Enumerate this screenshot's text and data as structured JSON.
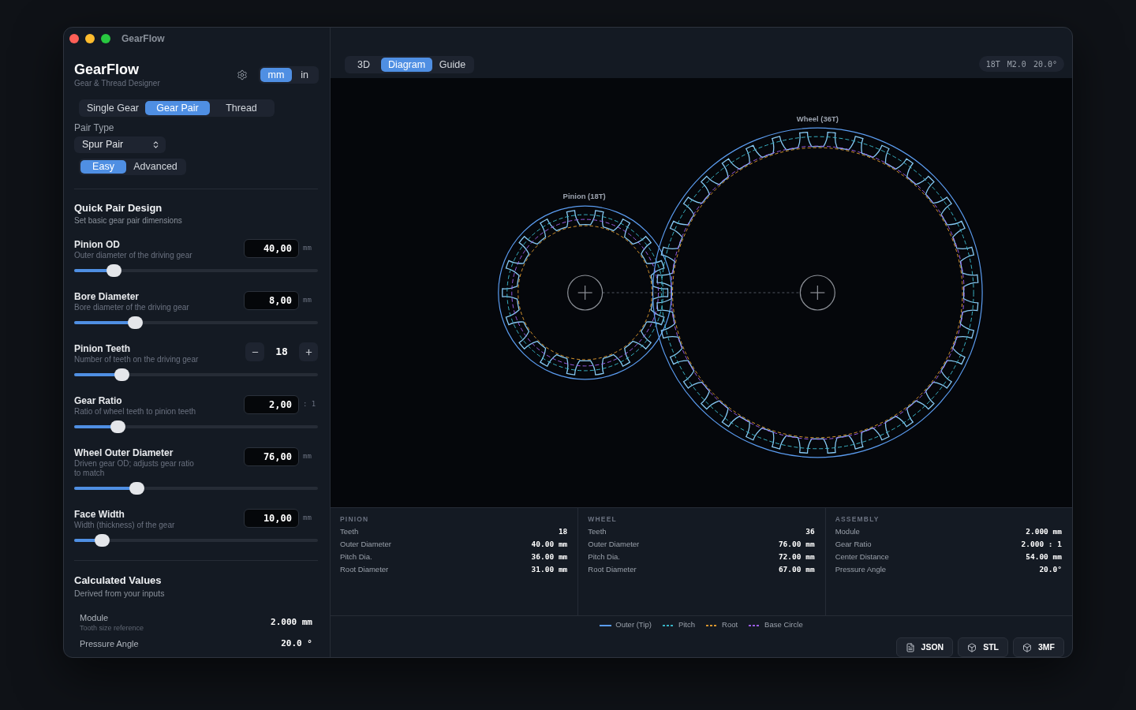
{
  "window": {
    "title": "GearFlow"
  },
  "sidebar": {
    "app_name": "GearFlow",
    "subtitle": "Gear & Thread Designer",
    "units": [
      {
        "label": "mm",
        "selected": true
      },
      {
        "label": "in",
        "selected": false
      }
    ],
    "modes": [
      {
        "label": "Single Gear",
        "selected": false
      },
      {
        "label": "Gear Pair",
        "selected": true
      },
      {
        "label": "Thread",
        "selected": false
      }
    ],
    "pair_type": {
      "label": "Pair Type",
      "value": "Spur Pair"
    },
    "complexity": [
      {
        "label": "Easy",
        "selected": true
      },
      {
        "label": "Advanced",
        "selected": false
      }
    ],
    "quick_design": {
      "title": "Quick Pair Design",
      "subtitle": "Set basic gear pair dimensions"
    },
    "params": [
      {
        "kind": "number",
        "label": "Pinion OD",
        "hint": "Outer diameter of the driving gear",
        "value": "40,00",
        "unit": "mm",
        "level": 0.165
      },
      {
        "kind": "number",
        "label": "Bore Diameter",
        "hint": "Bore diameter of the driving gear",
        "value": "8,00",
        "unit": "mm",
        "level": 0.25
      },
      {
        "kind": "stepper",
        "label": "Pinion Teeth",
        "hint": "Number of teeth on the driving gear",
        "value": "18",
        "level": 0.195
      },
      {
        "kind": "number",
        "label": "Gear Ratio",
        "hint": "Ratio of wheel teeth to pinion teeth",
        "value": "2,00",
        "unit": ": 1",
        "level": 0.178
      },
      {
        "kind": "number",
        "label": "Wheel Outer Diameter",
        "hint": "Driven gear OD; adjusts gear ratio to match",
        "value": "76,00",
        "unit": "mm",
        "level": 0.256
      },
      {
        "kind": "number",
        "label": "Face Width",
        "hint": "Width (thickness) of the gear",
        "value": "10,00",
        "unit": "mm",
        "level": 0.114
      }
    ],
    "calculated": {
      "title": "Calculated Values",
      "subtitle": "Derived from your inputs",
      "rows": [
        {
          "label": "Module",
          "hint": "Tooth size reference",
          "value": "2.000 mm"
        },
        {
          "label": "Pressure Angle",
          "value": "20.0 °"
        }
      ]
    }
  },
  "toolbar": {
    "view_tabs": [
      {
        "label": "3D",
        "selected": false
      },
      {
        "label": "Diagram",
        "selected": true
      },
      {
        "label": "Guide",
        "selected": false
      }
    ],
    "summary": [
      "18T",
      "M2.0",
      "20.0°"
    ]
  },
  "diagram": {
    "pinion_label": "Pinion (18T)",
    "wheel_label": "Wheel (36T)"
  },
  "stats": [
    {
      "heading": "PINION",
      "rows": [
        {
          "label": "Teeth",
          "value": "18"
        },
        {
          "label": "Outer Diameter",
          "value": "40.00 mm"
        },
        {
          "label": "Pitch Dia.",
          "value": "36.00 mm"
        },
        {
          "label": "Root Diameter",
          "value": "31.00 mm"
        }
      ]
    },
    {
      "heading": "WHEEL",
      "rows": [
        {
          "label": "Teeth",
          "value": "36"
        },
        {
          "label": "Outer Diameter",
          "value": "76.00 mm"
        },
        {
          "label": "Pitch Dia.",
          "value": "72.00 mm"
        },
        {
          "label": "Root Diameter",
          "value": "67.00 mm"
        }
      ]
    },
    {
      "heading": "ASSEMBLY",
      "rows": [
        {
          "label": "Module",
          "value": "2.000 mm"
        },
        {
          "label": "Gear Ratio",
          "value": "2.000 : 1"
        },
        {
          "label": "Center Distance",
          "value": "54.00 mm"
        },
        {
          "label": "Pressure Angle",
          "value": "20.0°"
        }
      ]
    }
  ],
  "legend": [
    {
      "label": "Outer (Tip)",
      "kind": "solid",
      "color": "#5b9cf0"
    },
    {
      "label": "Pitch",
      "kind": "dashed",
      "color": "#38b2c4"
    },
    {
      "label": "Root",
      "kind": "dashed",
      "color": "#d8962e"
    },
    {
      "label": "Base Circle",
      "kind": "dashed",
      "color": "#9b5de5"
    }
  ],
  "export_buttons": [
    {
      "label": "JSON",
      "kind": "file"
    },
    {
      "label": "STL",
      "kind": "cube"
    },
    {
      "label": "3MF",
      "kind": "cube"
    }
  ]
}
